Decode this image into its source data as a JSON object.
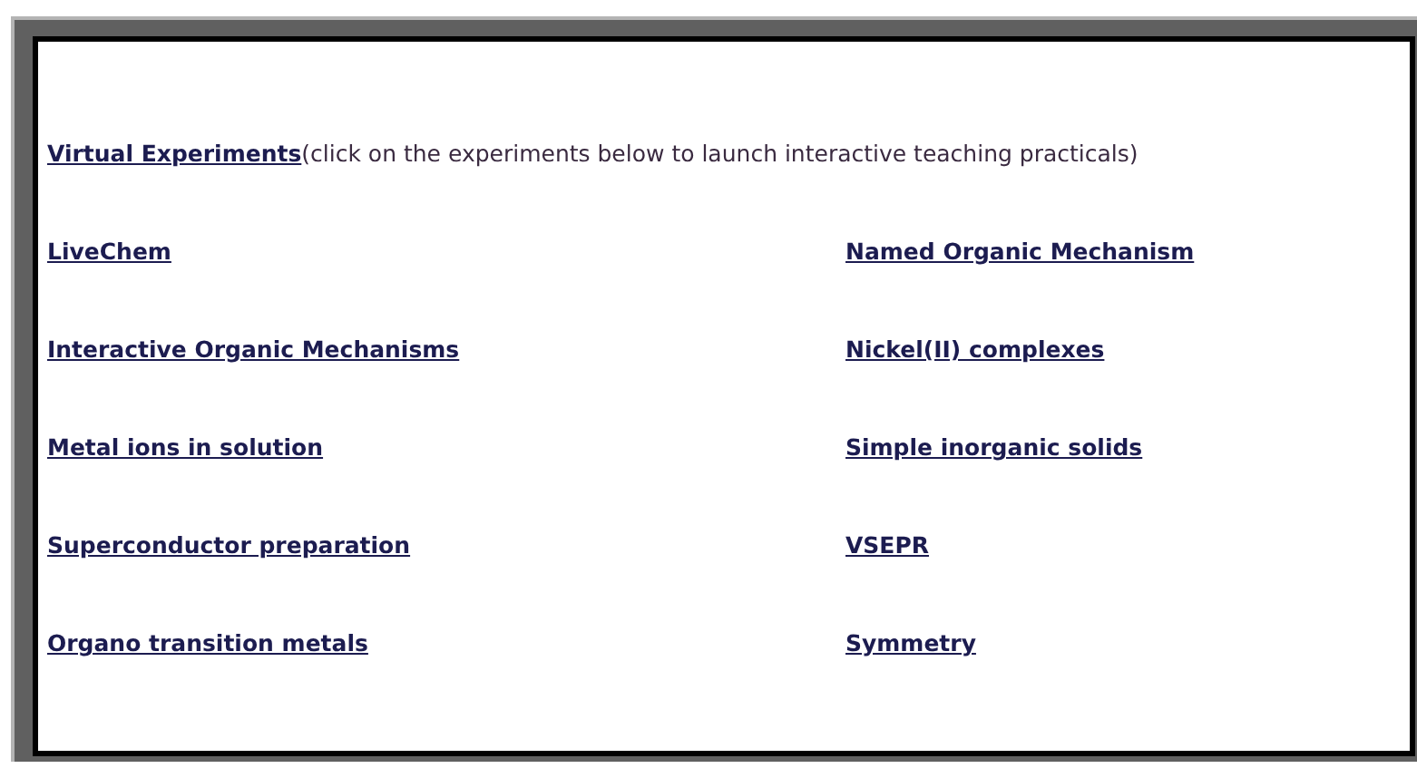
{
  "intro": {
    "link": "Virtual Experiments",
    "text": "(click on the experiments below to launch interactive teaching practicals)"
  },
  "experiments": [
    {
      "label": "LiveChem"
    },
    {
      "label": "Named Organic Mechanism"
    },
    {
      "label": "Interactive Organic Mechanisms"
    },
    {
      "label": "Nickel(II) complexes"
    },
    {
      "label": "Metal ions in solution"
    },
    {
      "label": "Simple inorganic solids"
    },
    {
      "label": "Superconductor preparation"
    },
    {
      "label": "VSEPR"
    },
    {
      "label": "Organo transition metals"
    },
    {
      "label": "Symmetry"
    }
  ]
}
